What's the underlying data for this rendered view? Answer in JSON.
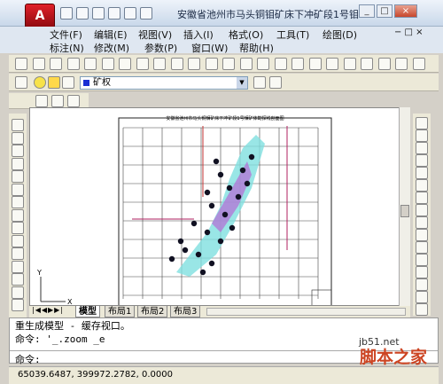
{
  "window": {
    "title": "安徽省池州市马头铜钼矿床下冲矿段1号钼...",
    "app_logo": "A"
  },
  "menu": {
    "row1": [
      "文件(F)",
      "编辑(E)",
      "视图(V)",
      "插入(I)",
      "格式(O)",
      "工具(T)",
      "绘图(D)"
    ],
    "row2": [
      "标注(N)",
      "修改(M)",
      "参数(P)",
      "窗口(W)",
      "帮助(H)"
    ]
  },
  "layer": {
    "current": "矿权"
  },
  "drawing": {
    "sheet_title": "安徽省池州市马头铜钼矿床下冲矿段1号钼矿体勘探线剖面图"
  },
  "tabs": [
    "模型",
    "布局1",
    "布局2",
    "布局3"
  ],
  "command": {
    "history_line1": "重生成模型 - 缓存视口。",
    "history_line2": "命令: '_.zoom _e",
    "prompt": "命令:"
  },
  "status": {
    "coordinates": "65039.6487, 399972.2782, 0.0000"
  },
  "watermark": {
    "site": "jb51.net",
    "name": "脚本之家"
  }
}
